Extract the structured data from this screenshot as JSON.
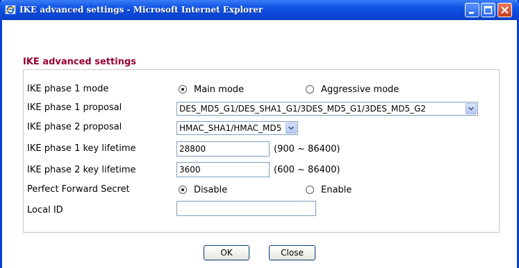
{
  "window": {
    "title": "IKE advanced settings - Microsoft Internet Explorer",
    "icon": "ie-icon",
    "controls": [
      "minimize-icon",
      "maximize-icon",
      "close-icon"
    ]
  },
  "heading": "IKE advanced settings",
  "rows": {
    "phase1_mode": {
      "label": "IKE phase 1 mode",
      "option_main": "Main mode",
      "option_aggressive": "Aggressive mode",
      "selected": "Main mode"
    },
    "phase1_proposal": {
      "label": "IKE phase 1 proposal",
      "value": "DES_MD5_G1/DES_SHA1_G1/3DES_MD5_G1/3DES_MD5_G2"
    },
    "phase2_proposal": {
      "label": "IKE phase 2 proposal",
      "value": "HMAC_SHA1/HMAC_MD5"
    },
    "phase1_lifetime": {
      "label": "IKE phase 1 key lifetime",
      "value": "28800",
      "hint": "(900 ~ 86400)"
    },
    "phase2_lifetime": {
      "label": "IKE phase 2 key lifetime",
      "value": "3600",
      "hint": "(600 ~ 86400)"
    },
    "pfs": {
      "label": "Perfect Forward Secret",
      "option_disable": "Disable",
      "option_enable": "Enable",
      "selected": "Disable"
    },
    "local_id": {
      "label": "Local ID",
      "value": ""
    }
  },
  "buttons": {
    "ok": "OK",
    "close": "Close"
  },
  "colors": {
    "titlebar": "#0a47d8",
    "heading": "#990033",
    "input_border": "#7f9db9"
  }
}
